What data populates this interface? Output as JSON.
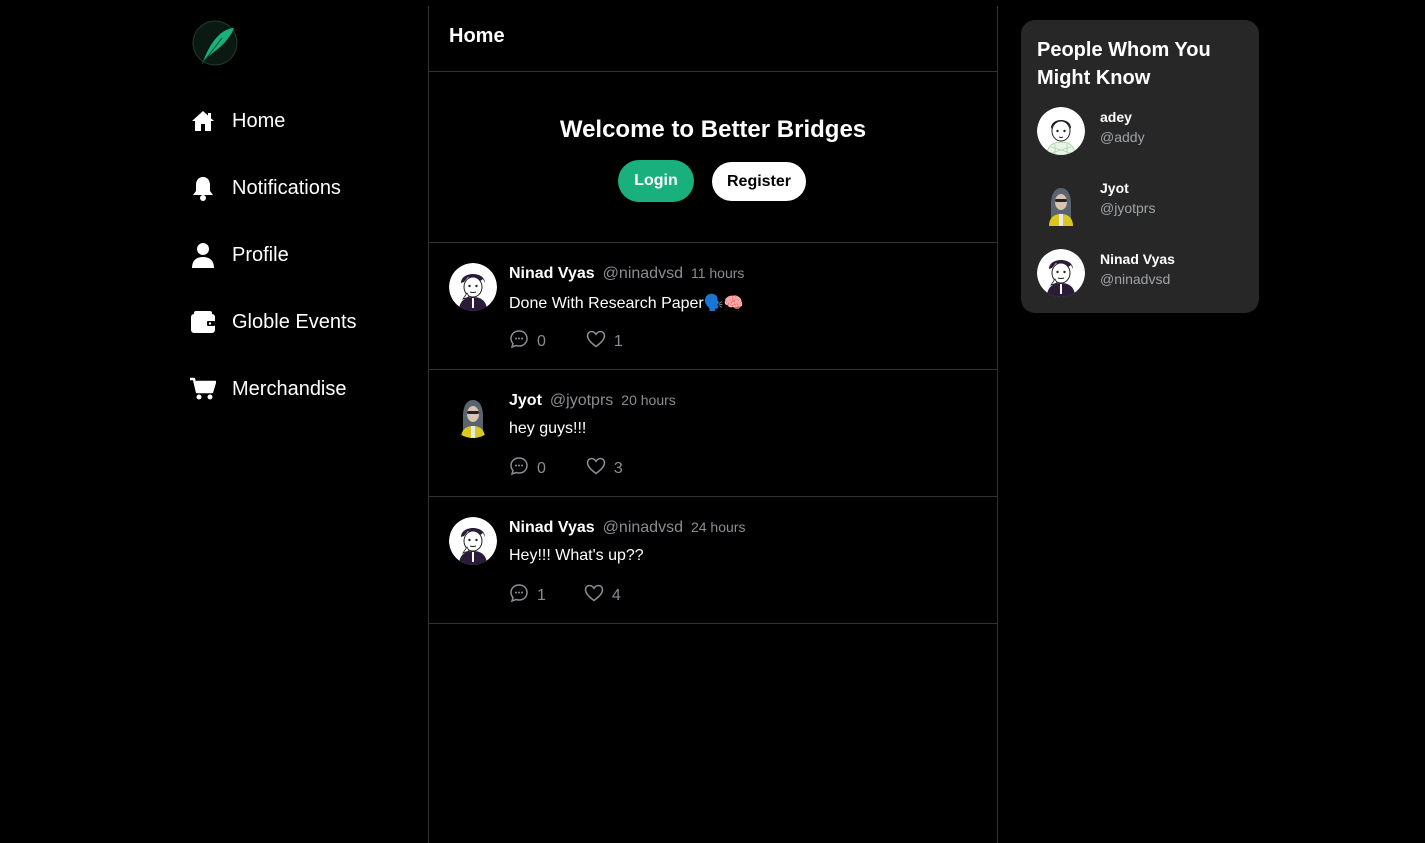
{
  "sidebar": {
    "items": [
      {
        "label": "Home",
        "icon": "home-icon"
      },
      {
        "label": "Notifications",
        "icon": "bell-icon"
      },
      {
        "label": "Profile",
        "icon": "user-icon"
      },
      {
        "label": "Globle Events",
        "icon": "wallet-icon"
      },
      {
        "label": "Merchandise",
        "icon": "cart-icon"
      }
    ]
  },
  "main": {
    "title": "Home",
    "welcome": {
      "title": "Welcome to Better Bridges",
      "login_label": "Login",
      "register_label": "Register"
    },
    "tweets": [
      {
        "name": "Ninad Vyas",
        "handle": "@ninadvsd",
        "time": "11 hours",
        "text": "Done With Research Paper🗣️🧠",
        "comments": "0",
        "likes": "1"
      },
      {
        "name": "Jyot",
        "handle": "@jyotprs",
        "time": "20 hours",
        "text": "hey guys!!!",
        "comments": "0",
        "likes": "3"
      },
      {
        "name": "Ninad Vyas",
        "handle": "@ninadvsd",
        "time": "24 hours",
        "text": "Hey!!! What's up??",
        "comments": "1",
        "likes": "4"
      }
    ]
  },
  "suggestions": {
    "title": "People Whom You Might Know",
    "people": [
      {
        "name": "adey",
        "handle": "@addy"
      },
      {
        "name": "Jyot",
        "handle": "@jyotprs"
      },
      {
        "name": "Ninad Vyas",
        "handle": "@ninadvsd"
      }
    ]
  },
  "colors": {
    "background": "#000000",
    "accent": "#19b07e",
    "panel": "#272727",
    "muted_text": "#8a8d91"
  }
}
